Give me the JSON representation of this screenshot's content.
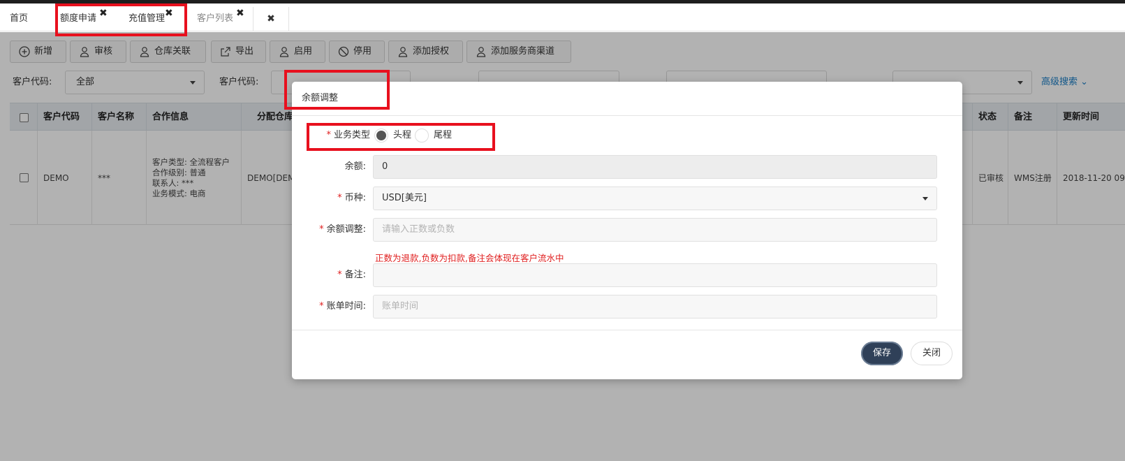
{
  "tabs": [
    {
      "label": "首页"
    },
    {
      "label": "额度申请"
    },
    {
      "label": "充值管理"
    },
    {
      "label": "客户列表"
    }
  ],
  "toolbar": [
    {
      "label": "新增",
      "icon": "plus-circle-icon"
    },
    {
      "label": "审核",
      "icon": "user-icon"
    },
    {
      "label": "仓库关联",
      "icon": "user-icon"
    },
    {
      "label": "导出",
      "icon": "export-icon"
    },
    {
      "label": "启用",
      "icon": "user-icon"
    },
    {
      "label": "停用",
      "icon": "ban-icon"
    },
    {
      "label": "添加授权",
      "icon": "user-icon"
    },
    {
      "label": "添加服务商渠道",
      "icon": "user-icon"
    }
  ],
  "filters": {
    "customer_code_label": "客户代码:",
    "customer_code_value": "全部",
    "customer_code2_label": "客户代码:",
    "advanced_search": "高级搜索"
  },
  "grid": {
    "headers": [
      "客户代码",
      "客户名称",
      "合作信息",
      "分配仓库",
      "状态",
      "备注",
      "更新时间"
    ],
    "row": {
      "code": "DEMO",
      "name": "***",
      "coop": [
        "客户类型: 全流程客户",
        "合作级别: 普通",
        "联系人: ***",
        "业务模式: 电商"
      ],
      "warehouse": "DEMO[DEM",
      "status": "已审核",
      "remark": "WMS注册",
      "updated": "2018-11-20 09:"
    }
  },
  "modal": {
    "title": "余额调整",
    "business_type_label": "业务类型",
    "radio_head": "头程",
    "radio_tail": "尾程",
    "selected": "head",
    "balance_label": "余额:",
    "balance_value": "0",
    "currency_label": "币种:",
    "currency_value": "USD[美元]",
    "adjust_label": "余额调整:",
    "adjust_placeholder": "请输入正数或负数",
    "hint": "正数为退款,负数为扣款,备注会体现在客户流水中",
    "remark_label": "备注:",
    "bill_time_label": "账单时间:",
    "bill_time_placeholder": "账单时间",
    "save": "保存",
    "close": "关闭"
  },
  "colors": {
    "highlight": "#e8101e",
    "primary": "#2f4058",
    "link": "#1a7dc4",
    "required": "#e02020"
  }
}
